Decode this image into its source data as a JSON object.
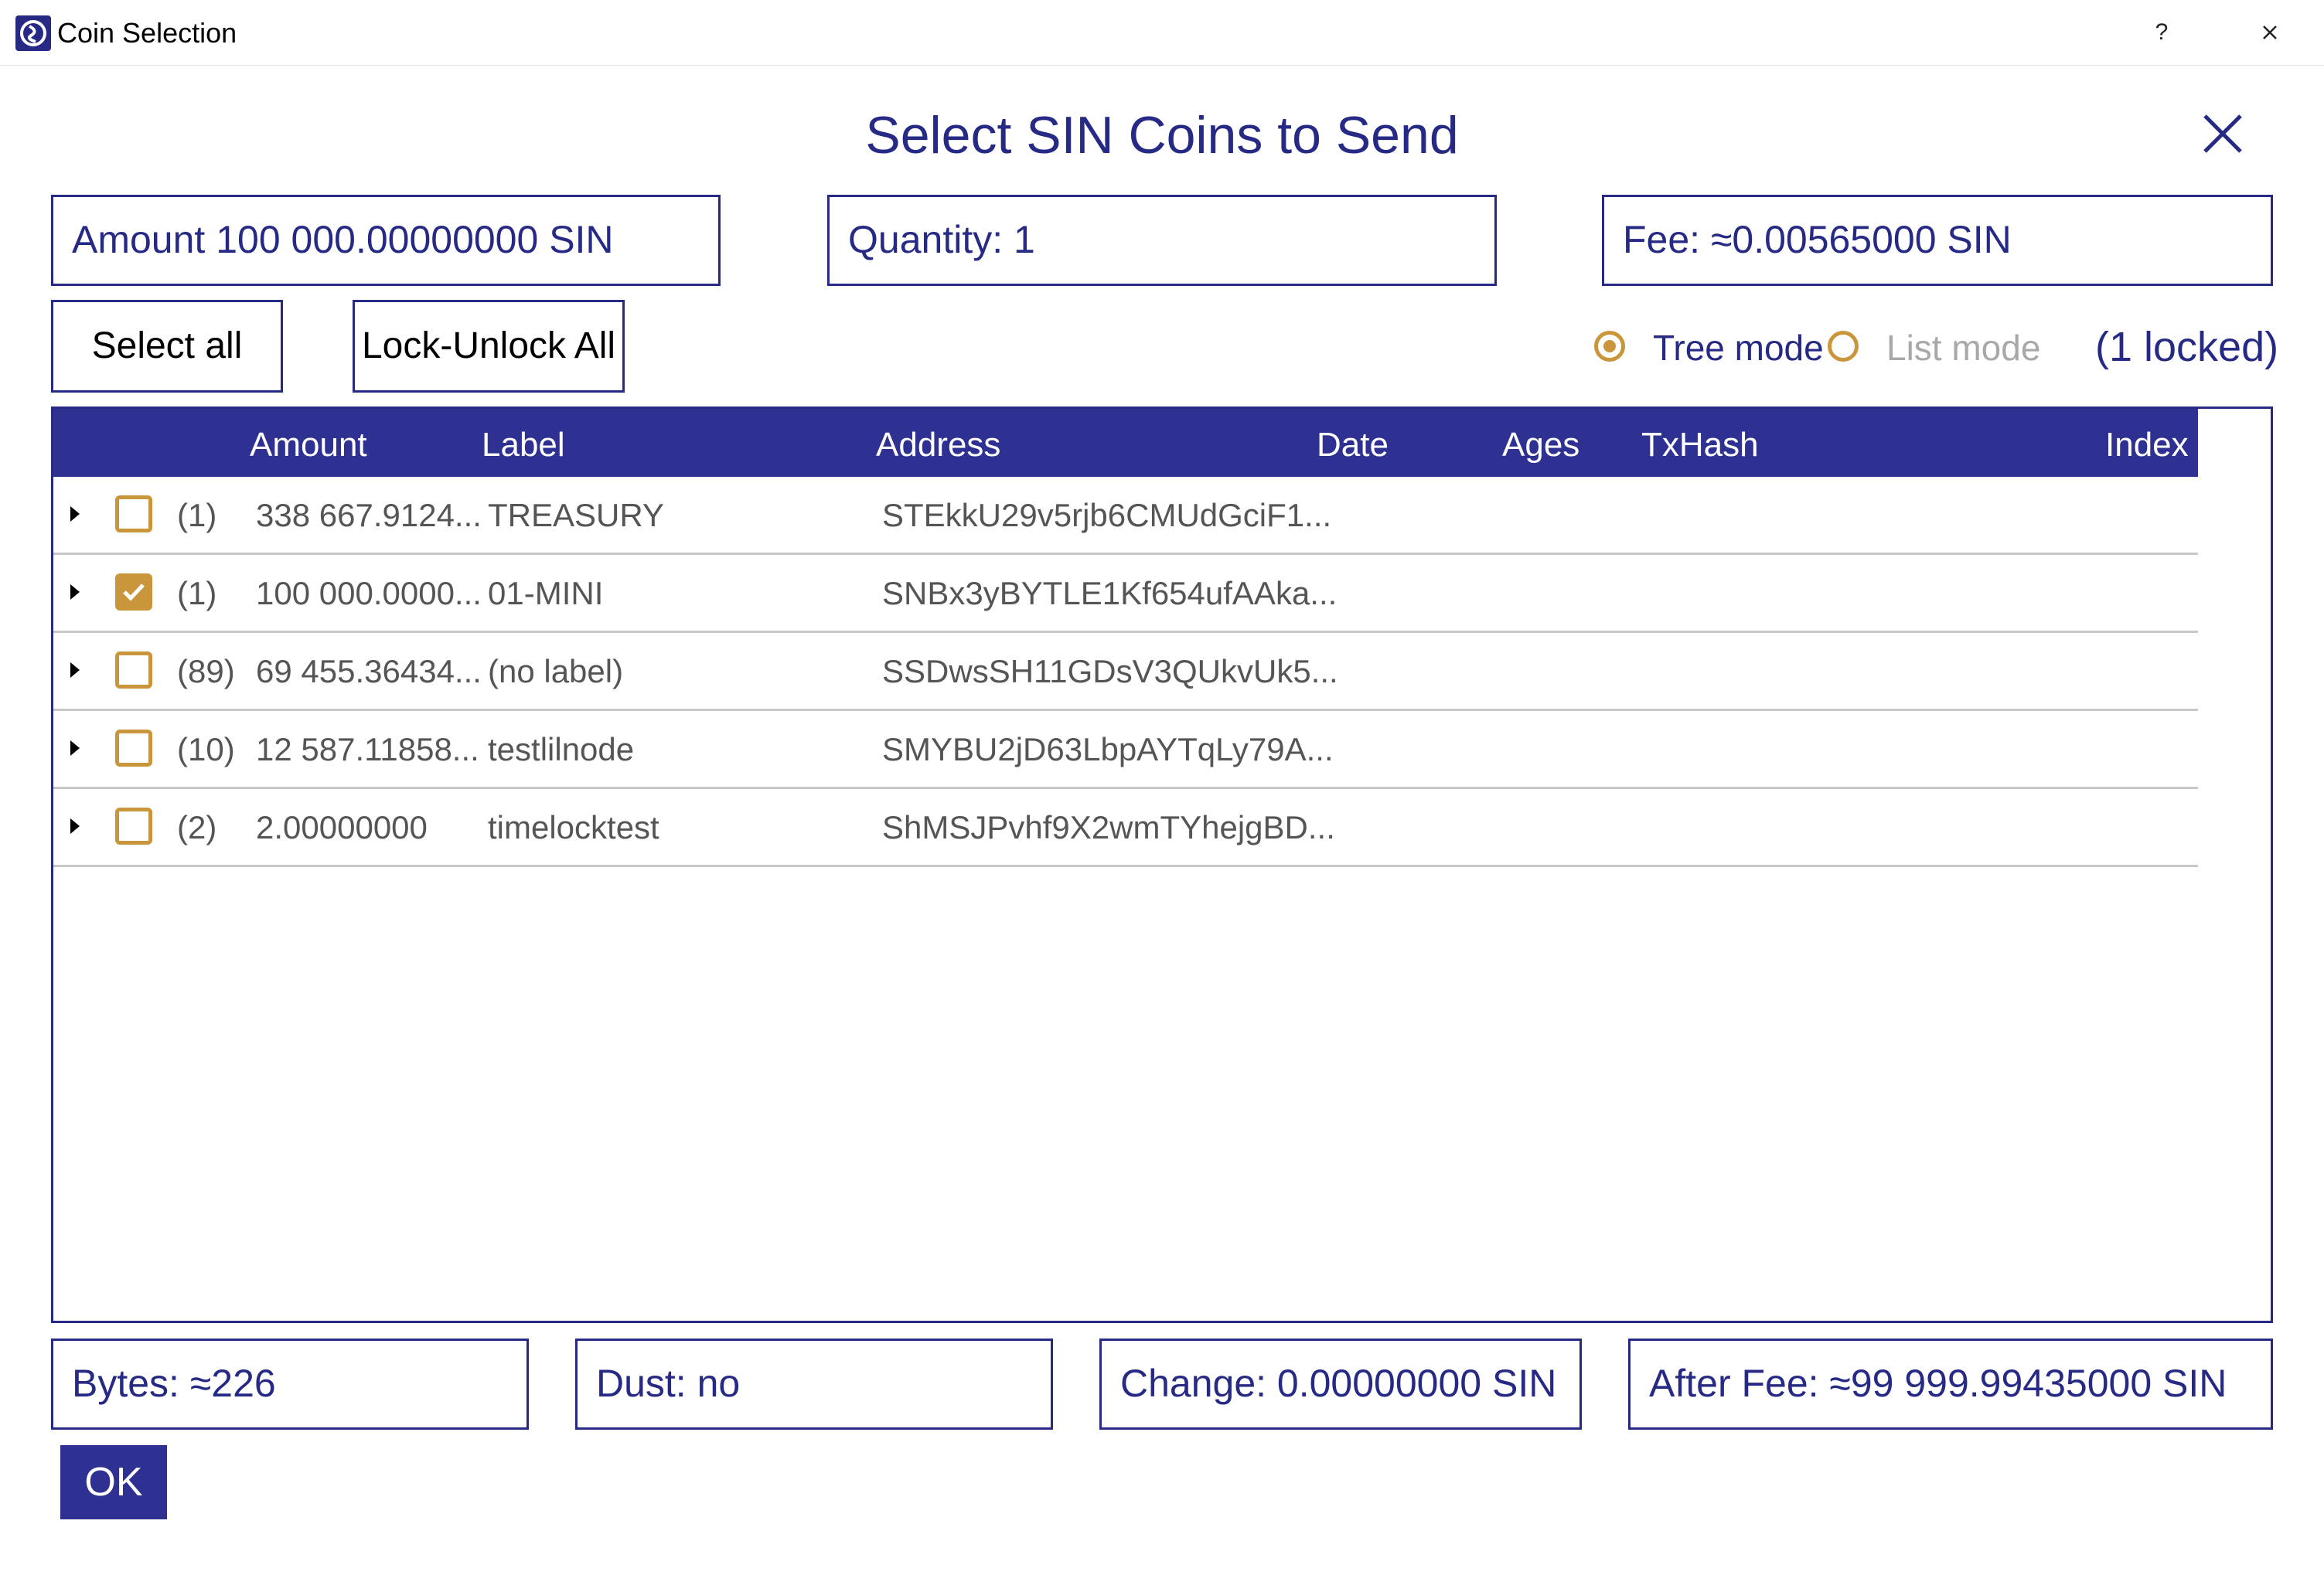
{
  "window": {
    "title": "Coin Selection",
    "help": "?"
  },
  "heading": "Select SIN Coins to Send",
  "summary": {
    "amount": "Amount  100 000.00000000 SIN",
    "quantity": "Quantity:  1",
    "fee": "Fee:  ≈0.00565000 SIN"
  },
  "buttons": {
    "select_all": "Select all",
    "lock_unlock": "Lock-Unlock All",
    "ok": "OK"
  },
  "mode": {
    "tree": "Tree mode",
    "list": "List mode",
    "selected": "tree",
    "locked": "(1 locked)"
  },
  "table": {
    "headers": [
      "Amount",
      "Label",
      "Address",
      "Date",
      "Ages",
      "TxHash",
      "Index"
    ],
    "rows": [
      {
        "checked": false,
        "count": "(1)",
        "amount": "338 667.9124...",
        "label": "TREASURY",
        "address": "STEkkU29v5rjb6CMUdGciF1..."
      },
      {
        "checked": true,
        "count": "(1)",
        "amount": "100 000.0000...",
        "label": "01-MINI",
        "address": "SNBx3yBYTLE1Kf654ufAAka..."
      },
      {
        "checked": false,
        "count": "(89)",
        "amount": "69 455.36434...",
        "label": "(no label)",
        "address": "SSDwsSH11GDsV3QUkvUk5..."
      },
      {
        "checked": false,
        "count": "(10)",
        "amount": "12 587.11858...",
        "label": "testlilnode",
        "address": "SMYBU2jD63LbpAYTqLy79A..."
      },
      {
        "checked": false,
        "count": "(2)",
        "amount": "2.00000000",
        "label": "timelocktest",
        "address": "ShMSJPvhf9X2wmTYhejgBD..."
      }
    ]
  },
  "footer": {
    "bytes": "Bytes:  ≈226",
    "dust": "Dust:  no",
    "change": "Change:  0.00000000 SIN",
    "after_fee": "After Fee:   ≈99 999.99435000 SIN"
  },
  "colors": {
    "primary": "#2e3192",
    "accent": "#c9963b",
    "text_blue": "#262a85"
  }
}
